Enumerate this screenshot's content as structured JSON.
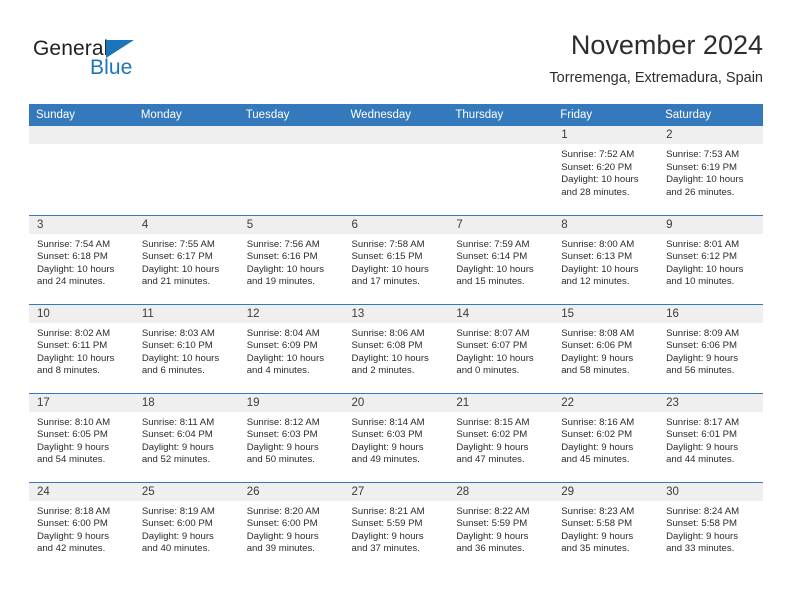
{
  "brand": {
    "name_part1": "General",
    "name_part2": "Blue",
    "triangle_color": "#1b75bb",
    "text_color": "#231f20"
  },
  "header": {
    "title": "November 2024",
    "subtitle": "Torremenga, Extremadura, Spain"
  },
  "calendar": {
    "accent_color": "#3479bc",
    "daynum_bg": "#efefef",
    "weekday_headers": [
      "Sunday",
      "Monday",
      "Tuesday",
      "Wednesday",
      "Thursday",
      "Friday",
      "Saturday"
    ],
    "weeks": [
      [
        {
          "day": "",
          "sunrise": "",
          "sunset": "",
          "daylight1": "",
          "daylight2": ""
        },
        {
          "day": "",
          "sunrise": "",
          "sunset": "",
          "daylight1": "",
          "daylight2": ""
        },
        {
          "day": "",
          "sunrise": "",
          "sunset": "",
          "daylight1": "",
          "daylight2": ""
        },
        {
          "day": "",
          "sunrise": "",
          "sunset": "",
          "daylight1": "",
          "daylight2": ""
        },
        {
          "day": "",
          "sunrise": "",
          "sunset": "",
          "daylight1": "",
          "daylight2": ""
        },
        {
          "day": "1",
          "sunrise": "Sunrise: 7:52 AM",
          "sunset": "Sunset: 6:20 PM",
          "daylight1": "Daylight: 10 hours",
          "daylight2": "and 28 minutes."
        },
        {
          "day": "2",
          "sunrise": "Sunrise: 7:53 AM",
          "sunset": "Sunset: 6:19 PM",
          "daylight1": "Daylight: 10 hours",
          "daylight2": "and 26 minutes."
        }
      ],
      [
        {
          "day": "3",
          "sunrise": "Sunrise: 7:54 AM",
          "sunset": "Sunset: 6:18 PM",
          "daylight1": "Daylight: 10 hours",
          "daylight2": "and 24 minutes."
        },
        {
          "day": "4",
          "sunrise": "Sunrise: 7:55 AM",
          "sunset": "Sunset: 6:17 PM",
          "daylight1": "Daylight: 10 hours",
          "daylight2": "and 21 minutes."
        },
        {
          "day": "5",
          "sunrise": "Sunrise: 7:56 AM",
          "sunset": "Sunset: 6:16 PM",
          "daylight1": "Daylight: 10 hours",
          "daylight2": "and 19 minutes."
        },
        {
          "day": "6",
          "sunrise": "Sunrise: 7:58 AM",
          "sunset": "Sunset: 6:15 PM",
          "daylight1": "Daylight: 10 hours",
          "daylight2": "and 17 minutes."
        },
        {
          "day": "7",
          "sunrise": "Sunrise: 7:59 AM",
          "sunset": "Sunset: 6:14 PM",
          "daylight1": "Daylight: 10 hours",
          "daylight2": "and 15 minutes."
        },
        {
          "day": "8",
          "sunrise": "Sunrise: 8:00 AM",
          "sunset": "Sunset: 6:13 PM",
          "daylight1": "Daylight: 10 hours",
          "daylight2": "and 12 minutes."
        },
        {
          "day": "9",
          "sunrise": "Sunrise: 8:01 AM",
          "sunset": "Sunset: 6:12 PM",
          "daylight1": "Daylight: 10 hours",
          "daylight2": "and 10 minutes."
        }
      ],
      [
        {
          "day": "10",
          "sunrise": "Sunrise: 8:02 AM",
          "sunset": "Sunset: 6:11 PM",
          "daylight1": "Daylight: 10 hours",
          "daylight2": "and 8 minutes."
        },
        {
          "day": "11",
          "sunrise": "Sunrise: 8:03 AM",
          "sunset": "Sunset: 6:10 PM",
          "daylight1": "Daylight: 10 hours",
          "daylight2": "and 6 minutes."
        },
        {
          "day": "12",
          "sunrise": "Sunrise: 8:04 AM",
          "sunset": "Sunset: 6:09 PM",
          "daylight1": "Daylight: 10 hours",
          "daylight2": "and 4 minutes."
        },
        {
          "day": "13",
          "sunrise": "Sunrise: 8:06 AM",
          "sunset": "Sunset: 6:08 PM",
          "daylight1": "Daylight: 10 hours",
          "daylight2": "and 2 minutes."
        },
        {
          "day": "14",
          "sunrise": "Sunrise: 8:07 AM",
          "sunset": "Sunset: 6:07 PM",
          "daylight1": "Daylight: 10 hours",
          "daylight2": "and 0 minutes."
        },
        {
          "day": "15",
          "sunrise": "Sunrise: 8:08 AM",
          "sunset": "Sunset: 6:06 PM",
          "daylight1": "Daylight: 9 hours",
          "daylight2": "and 58 minutes."
        },
        {
          "day": "16",
          "sunrise": "Sunrise: 8:09 AM",
          "sunset": "Sunset: 6:06 PM",
          "daylight1": "Daylight: 9 hours",
          "daylight2": "and 56 minutes."
        }
      ],
      [
        {
          "day": "17",
          "sunrise": "Sunrise: 8:10 AM",
          "sunset": "Sunset: 6:05 PM",
          "daylight1": "Daylight: 9 hours",
          "daylight2": "and 54 minutes."
        },
        {
          "day": "18",
          "sunrise": "Sunrise: 8:11 AM",
          "sunset": "Sunset: 6:04 PM",
          "daylight1": "Daylight: 9 hours",
          "daylight2": "and 52 minutes."
        },
        {
          "day": "19",
          "sunrise": "Sunrise: 8:12 AM",
          "sunset": "Sunset: 6:03 PM",
          "daylight1": "Daylight: 9 hours",
          "daylight2": "and 50 minutes."
        },
        {
          "day": "20",
          "sunrise": "Sunrise: 8:14 AM",
          "sunset": "Sunset: 6:03 PM",
          "daylight1": "Daylight: 9 hours",
          "daylight2": "and 49 minutes."
        },
        {
          "day": "21",
          "sunrise": "Sunrise: 8:15 AM",
          "sunset": "Sunset: 6:02 PM",
          "daylight1": "Daylight: 9 hours",
          "daylight2": "and 47 minutes."
        },
        {
          "day": "22",
          "sunrise": "Sunrise: 8:16 AM",
          "sunset": "Sunset: 6:02 PM",
          "daylight1": "Daylight: 9 hours",
          "daylight2": "and 45 minutes."
        },
        {
          "day": "23",
          "sunrise": "Sunrise: 8:17 AM",
          "sunset": "Sunset: 6:01 PM",
          "daylight1": "Daylight: 9 hours",
          "daylight2": "and 44 minutes."
        }
      ],
      [
        {
          "day": "24",
          "sunrise": "Sunrise: 8:18 AM",
          "sunset": "Sunset: 6:00 PM",
          "daylight1": "Daylight: 9 hours",
          "daylight2": "and 42 minutes."
        },
        {
          "day": "25",
          "sunrise": "Sunrise: 8:19 AM",
          "sunset": "Sunset: 6:00 PM",
          "daylight1": "Daylight: 9 hours",
          "daylight2": "and 40 minutes."
        },
        {
          "day": "26",
          "sunrise": "Sunrise: 8:20 AM",
          "sunset": "Sunset: 6:00 PM",
          "daylight1": "Daylight: 9 hours",
          "daylight2": "and 39 minutes."
        },
        {
          "day": "27",
          "sunrise": "Sunrise: 8:21 AM",
          "sunset": "Sunset: 5:59 PM",
          "daylight1": "Daylight: 9 hours",
          "daylight2": "and 37 minutes."
        },
        {
          "day": "28",
          "sunrise": "Sunrise: 8:22 AM",
          "sunset": "Sunset: 5:59 PM",
          "daylight1": "Daylight: 9 hours",
          "daylight2": "and 36 minutes."
        },
        {
          "day": "29",
          "sunrise": "Sunrise: 8:23 AM",
          "sunset": "Sunset: 5:58 PM",
          "daylight1": "Daylight: 9 hours",
          "daylight2": "and 35 minutes."
        },
        {
          "day": "30",
          "sunrise": "Sunrise: 8:24 AM",
          "sunset": "Sunset: 5:58 PM",
          "daylight1": "Daylight: 9 hours",
          "daylight2": "and 33 minutes."
        }
      ]
    ]
  }
}
